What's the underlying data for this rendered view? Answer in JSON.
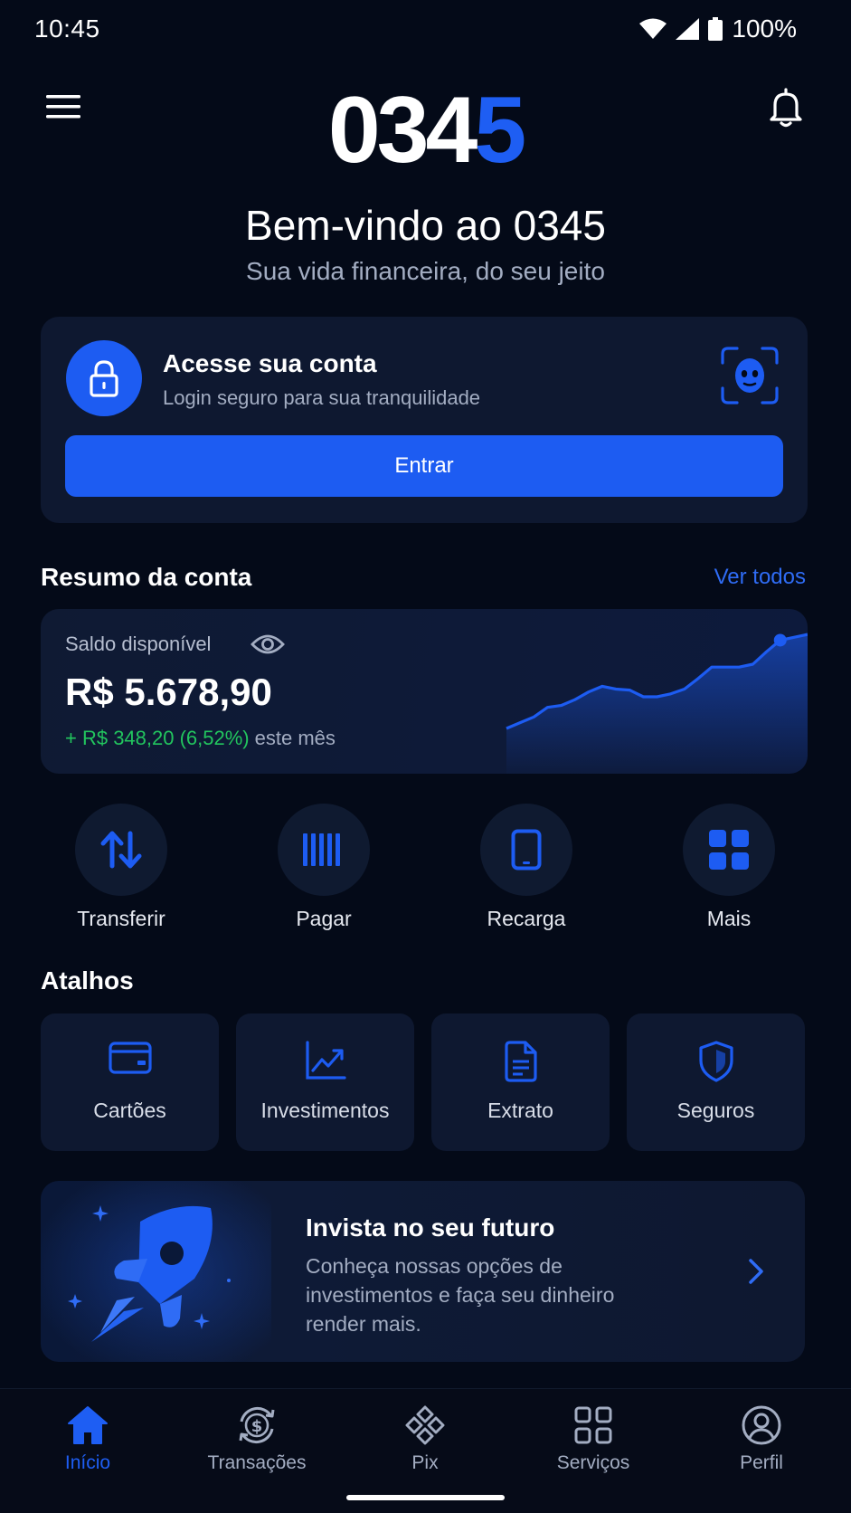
{
  "status_bar": {
    "time": "10:45",
    "battery": "100%"
  },
  "app": {
    "logo_main": "034",
    "logo_accent": "5",
    "accent_color": "#1d5cf2",
    "background_color": "#040a18"
  },
  "header": {
    "menu_icon": "hamburger-menu-icon",
    "notification_icon": "bell-icon"
  },
  "welcome": {
    "title": "Bem-vindo ao 0345",
    "subtitle": "Sua vida financeira, do seu jeito"
  },
  "login_card": {
    "title": "Acesse sua conta",
    "subtitle": "Login seguro para sua tranquilidade",
    "button_label": "Entrar",
    "icons": [
      "lock-icon",
      "face-id-icon"
    ]
  },
  "summary": {
    "section_title": "Resumo da conta",
    "see_all_label": "Ver todos",
    "balance_label": "Saldo disponível",
    "balance_value": "R$ 5.678,90",
    "change_value": "+ R$ 348,20 (6,52%)",
    "change_suffix": "este mês",
    "change_color": "#22c55e",
    "sparkline": [
      0,
      6,
      12,
      22,
      24,
      30,
      38,
      44,
      41,
      40,
      33,
      33,
      36,
      41,
      52,
      64,
      64,
      64,
      67,
      80,
      92,
      95,
      98
    ]
  },
  "quick_actions": [
    {
      "label": "Transferir",
      "icon": "transfer-arrows-icon"
    },
    {
      "label": "Pagar",
      "icon": "barcode-icon"
    },
    {
      "label": "Recarga",
      "icon": "phone-icon"
    },
    {
      "label": "Mais",
      "icon": "grid-icon"
    }
  ],
  "shortcuts": {
    "section_title": "Atalhos",
    "items": [
      {
        "label": "Cartões",
        "icon": "card-icon"
      },
      {
        "label": "Investimentos",
        "icon": "chart-up-icon"
      },
      {
        "label": "Extrato",
        "icon": "document-icon"
      },
      {
        "label": "Seguros",
        "icon": "shield-icon"
      }
    ]
  },
  "promo": {
    "title": "Invista no seu futuro",
    "body": "Conheça nossas opções de investimentos e faça seu dinheiro render mais.",
    "icon": "rocket-icon"
  },
  "bottom_nav": {
    "active": "Início",
    "items": [
      {
        "label": "Início",
        "icon": "home-icon"
      },
      {
        "label": "Transações",
        "icon": "transactions-icon"
      },
      {
        "label": "Pix",
        "icon": "pix-icon"
      },
      {
        "label": "Serviços",
        "icon": "services-icon"
      },
      {
        "label": "Perfil",
        "icon": "profile-icon"
      }
    ]
  }
}
